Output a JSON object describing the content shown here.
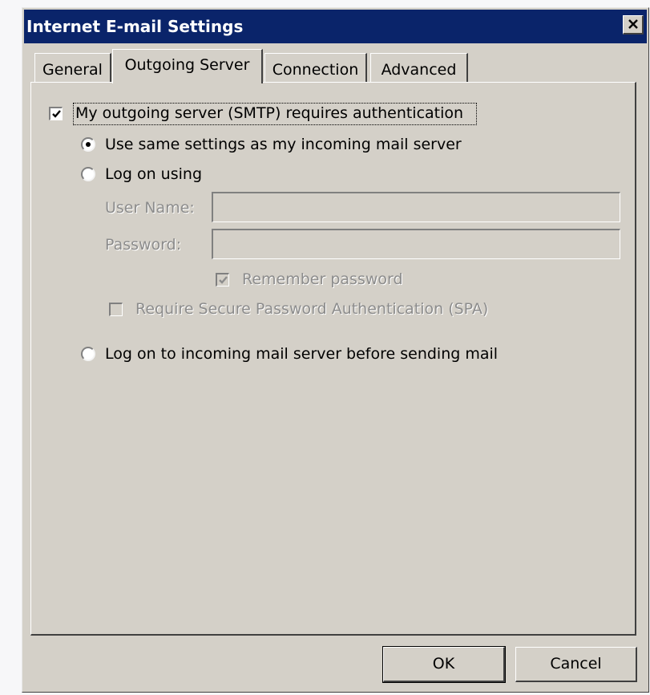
{
  "window": {
    "title": "Internet E-mail Settings"
  },
  "tabs": [
    {
      "label": "General",
      "active": false
    },
    {
      "label": "Outgoing Server",
      "active": true
    },
    {
      "label": "Connection",
      "active": false
    },
    {
      "label": "Advanced",
      "active": false
    }
  ],
  "auth": {
    "requires_auth_label": "My outgoing server (SMTP) requires authentication",
    "requires_auth_checked": true,
    "same_settings_label": "Use same settings as my incoming mail server",
    "log_on_using_label": "Log on using",
    "selected_option": "same_settings",
    "user_name_label": "User Name:",
    "user_name_value": "",
    "password_label": "Password:",
    "password_value": "",
    "remember_password_label": "Remember password",
    "remember_password_checked": true,
    "spa_label": "Require Secure Password Authentication (SPA)",
    "spa_checked": false,
    "log_on_incoming_label": "Log on to incoming mail server before sending mail"
  },
  "buttons": {
    "ok": "OK",
    "cancel": "Cancel"
  }
}
